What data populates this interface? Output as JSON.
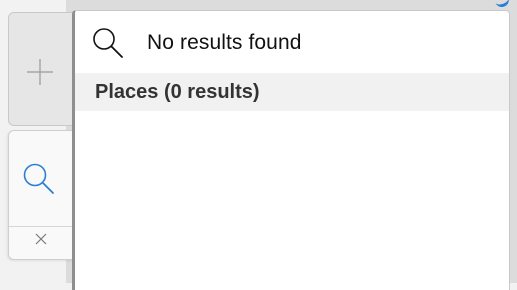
{
  "search": {
    "status_text": "No results found"
  },
  "results": {
    "section_title": "Places (0 results)",
    "items": []
  },
  "side_tabs": {
    "add_icon": "plus-icon",
    "search_icon": "search-icon",
    "close_icon": "close-icon"
  },
  "colors": {
    "accent": "#2a7fd4",
    "section_bg": "#f1f1f1"
  }
}
